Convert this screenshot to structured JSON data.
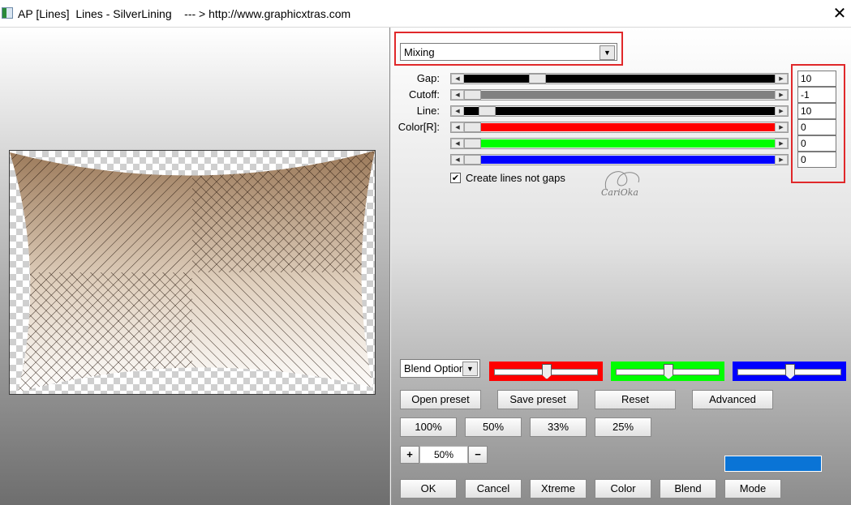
{
  "window": {
    "title": "AP [Lines]  Lines - SilverLining    --- > http://www.graphicxtras.com",
    "close_label": "✕"
  },
  "mode_select": {
    "value": "Mixing"
  },
  "sliders": [
    {
      "label": "Gap:",
      "value": "10",
      "track_color": "#000000",
      "level": 0.22
    },
    {
      "label": "Cutoff:",
      "value": "-1",
      "track_color": "#808080",
      "level": 0.0
    },
    {
      "label": "Line:",
      "value": "10",
      "track_color": "#000000",
      "level": 0.05
    },
    {
      "label": "Color[R]:",
      "value": "0",
      "track_color": "#ff0000",
      "level": 0.0
    },
    {
      "label": "",
      "value": "0",
      "track_color": "#00ff00",
      "level": 0.0
    },
    {
      "label": "",
      "value": "0",
      "track_color": "#0000ff",
      "level": 0.0
    }
  ],
  "create_lines_checkbox": {
    "label": "Create lines not gaps",
    "checked": true,
    "mark": "✔"
  },
  "watermark": "CariOka",
  "blend_options": {
    "value": "Blend Option",
    "color_sliders": [
      {
        "color": "#ff0000",
        "level": 0.5
      },
      {
        "color": "#00ff00",
        "level": 0.5
      },
      {
        "color": "#0000ff",
        "level": 0.5
      }
    ]
  },
  "buttons": {
    "open_preset": "Open preset",
    "save_preset": "Save preset",
    "reset": "Reset",
    "advanced": "Advanced",
    "zoom_100": "100%",
    "zoom_50": "50%",
    "zoom_33": "33%",
    "zoom_25": "25%",
    "zoom_plus": "+",
    "zoom_minus": "−",
    "ok": "OK",
    "cancel": "Cancel",
    "xtreme": "Xtreme",
    "color": "Color",
    "blend": "Blend",
    "mode": "Mode"
  },
  "zoom_value": "50%",
  "color_swatch": "#0a74d6",
  "icons": {
    "dropdown": "chevron-down-icon",
    "close": "close-icon",
    "check": "check-icon"
  }
}
